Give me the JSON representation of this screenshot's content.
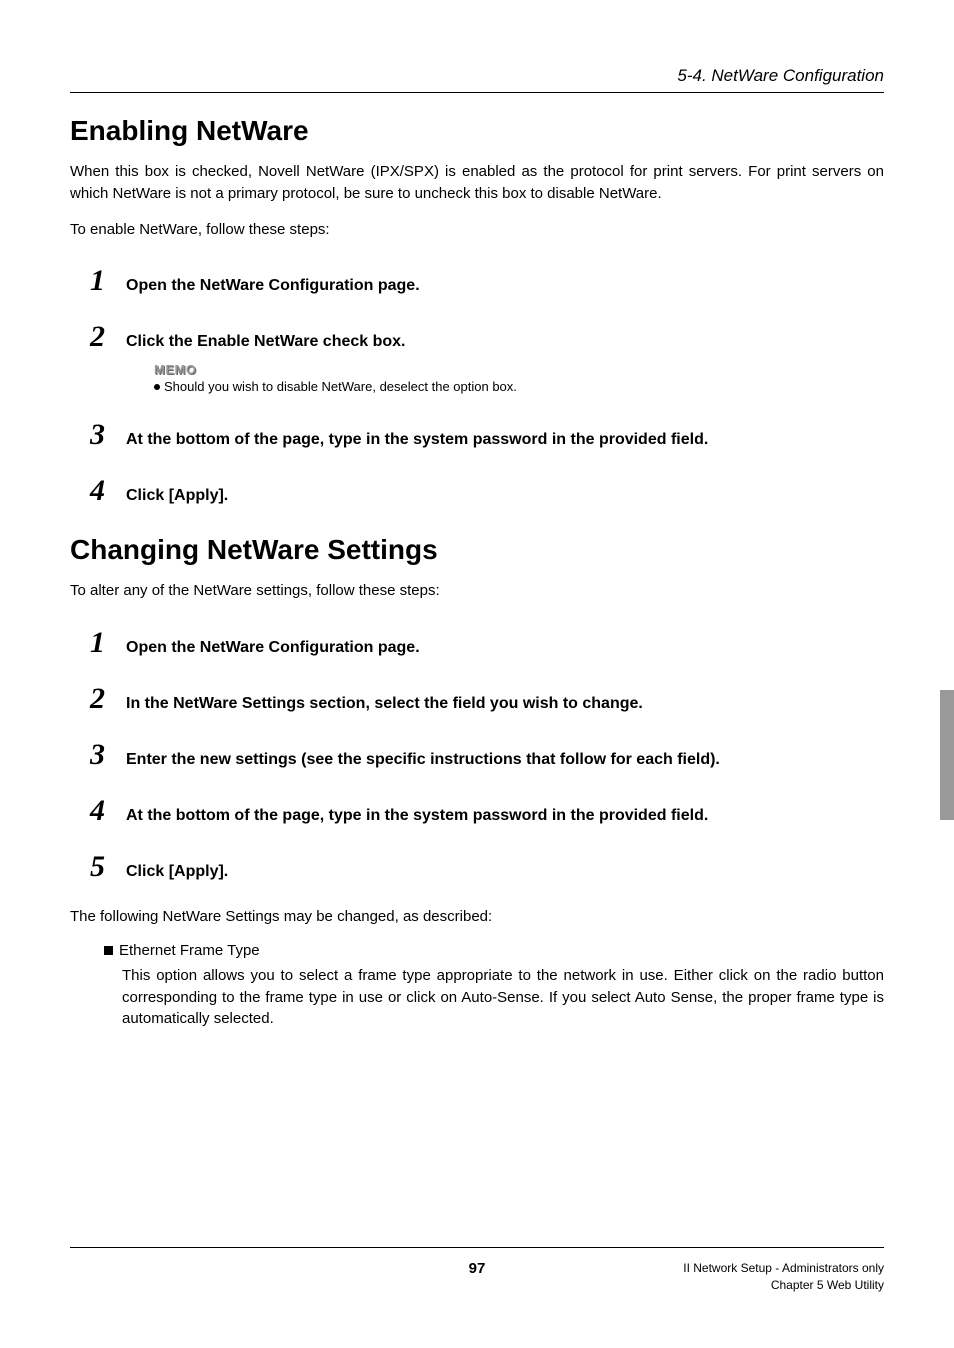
{
  "header": {
    "section": "5-4. NetWare Configuration"
  },
  "section1": {
    "title": "Enabling NetWare",
    "intro": "When this box is checked, Novell NetWare (IPX/SPX) is enabled as the protocol for print servers. For print servers on which NetWare is not a primary protocol, be sure to uncheck this box to disable NetWare.",
    "lead": "To enable NetWare, follow these steps:",
    "steps": [
      "Open the NetWare Configuration page.",
      "Click the Enable NetWare check box.",
      "At the bottom of the page, type in the system password in the provided field.",
      "Click [Apply]."
    ],
    "memo_label": "MEMO",
    "memo_item": "Should you wish to disable NetWare, deselect the option box."
  },
  "section2": {
    "title": "Changing NetWare Settings",
    "intro": "To alter any of the NetWare settings, follow these steps:",
    "steps": [
      "Open the NetWare Configuration page.",
      "In the NetWare Settings section, select the field you wish to change.",
      "Enter the new settings (see the specific instructions that follow for each field).",
      "At the bottom of the page, type in the system password in the provided field.",
      "Click [Apply]."
    ],
    "after": "The following NetWare Settings may be changed, as described:",
    "bullet_title": "Ethernet Frame Type",
    "bullet_body": "This option allows you to select a frame type appropriate to the network in use. Either click on the radio button corresponding to the frame type in use or click on Auto-Sense. If you select  Auto Sense, the proper frame type is automatically selected."
  },
  "footer": {
    "page": "97",
    "right1": "II Network Setup - Administrators only",
    "right2": "Chapter 5 Web Utility"
  }
}
